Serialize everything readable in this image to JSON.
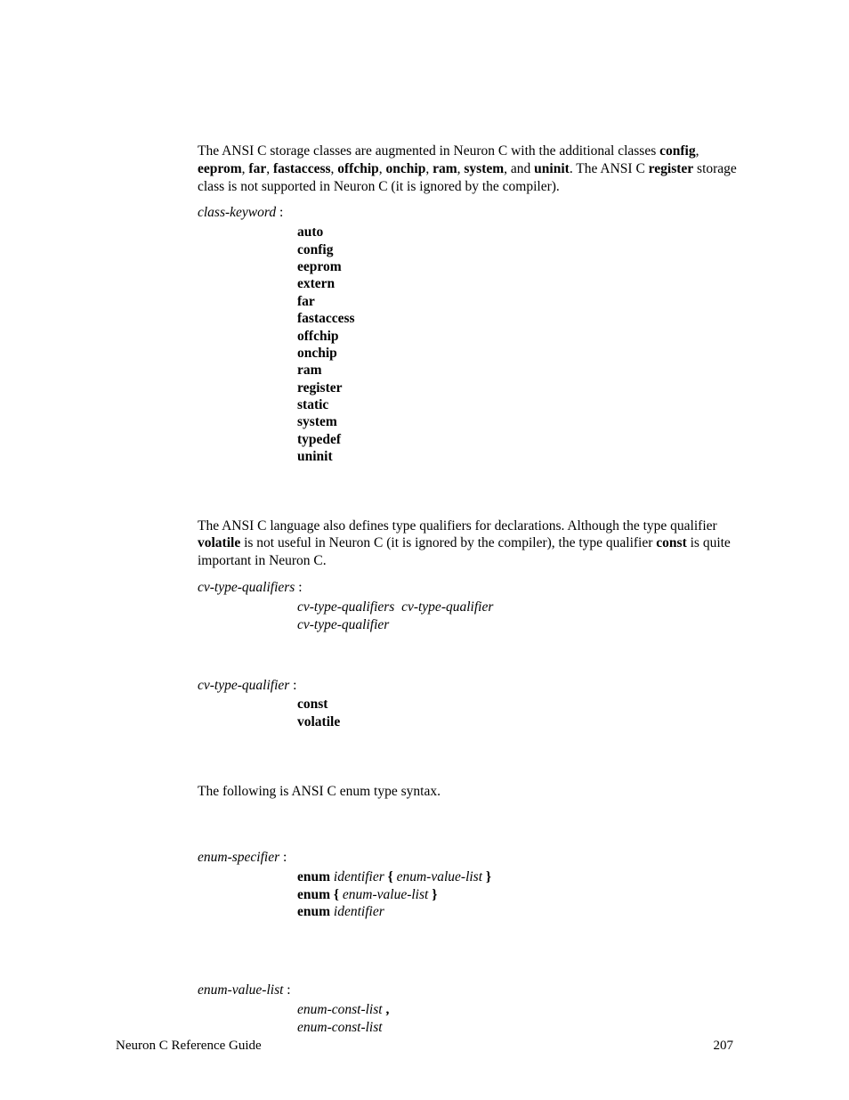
{
  "para1": {
    "pre": "The ANSI C storage classes are augmented in Neuron C with the additional classes ",
    "k1": "config",
    "c1": ", ",
    "k2": "eeprom",
    "c2": ", ",
    "k3": "far",
    "c3": ", ",
    "k4": "fastaccess",
    "c4": ", ",
    "k5": "offchip",
    "c5": ", ",
    "k6": "onchip",
    "c6": ", ",
    "k7": "ram",
    "c7": ", ",
    "k8": "system",
    "c8": ", and ",
    "k9": "uninit",
    "c9": ". The ANSI C ",
    "k10": "register",
    "post": " storage class is not supported in Neuron C (it is ignored by the compiler)."
  },
  "ck_label": "class-keyword",
  "colon": " :",
  "keywords": {
    "w0": "auto",
    "w1": "config",
    "w2": "eeprom",
    "w3": "extern",
    "w4": "far",
    "w5": "fastaccess",
    "w6": "offchip",
    "w7": "onchip",
    "w8": "ram",
    "w9": "register",
    "w10": "static",
    "w11": "system",
    "w12": "typedef",
    "w13": "uninit"
  },
  "para2": {
    "pre": "The ANSI C language also defines type qualifiers for declarations.  Although the type qualifier ",
    "k1": "volatile",
    "mid": " is not useful in Neuron C (it is ignored by the compiler), the type qualifier ",
    "k2": "const",
    "post": " is quite important in Neuron C."
  },
  "cvqs_label": "cv-type-qualifiers",
  "cvqs_line1a": "cv-type-qualifiers",
  "cvqs_line1b": "cv-type-qualifier",
  "cvqs_line2": "cv-type-qualifier",
  "cvq_label": "cv-type-qualifier",
  "cvq_const": "const",
  "cvq_volatile": "volatile",
  "para3": "The following is ANSI C enum type syntax.",
  "es_label": "enum-specifier",
  "es1_enum": "enum",
  "es1_id": "identifier",
  "es1_lb": " { ",
  "es1_evl": "enum-value-list",
  "es1_rb": " }",
  "es2_enum": "enum",
  "es2_lb": " { ",
  "es2_evl": "enum-value-list",
  "es2_rb": " }",
  "es3_enum": "enum",
  "es3_id": "identifier",
  "evl_label": "enum-value-list",
  "evl_line1": "enum-const-list",
  "evl_comma": " ,",
  "evl_line2": "enum-const-list",
  "footer_left": "Neuron C Reference Guide",
  "footer_right": "207"
}
